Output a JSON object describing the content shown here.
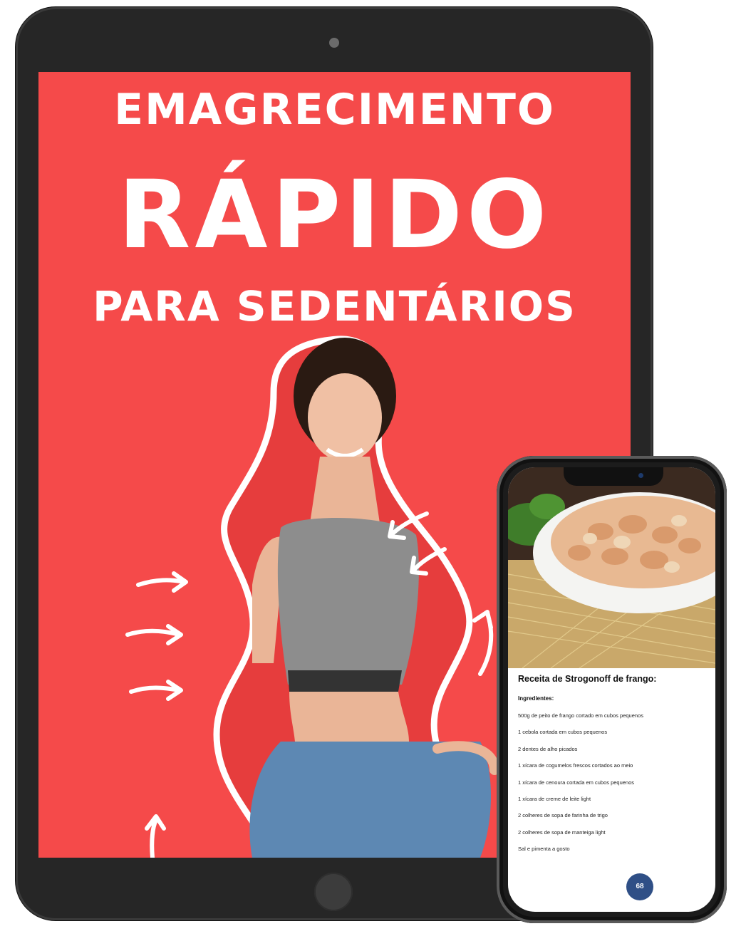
{
  "cover": {
    "title_line1": "EMAGRECIMENTO",
    "title_line2": "RÁPIDO",
    "title_line3": "PARA SEDENTÁRIOS",
    "background_color": "#f54a4a",
    "text_color": "#ffffff"
  },
  "recipe": {
    "title": "Receita de Strogonoff de frango:",
    "ingredients_label": "Ingredientes:",
    "ingredients": [
      "500g de peito de frango cortado em cubos pequenos",
      "1 cebola cortada em cubos pequenos",
      "2 dentes de alho picados",
      "1 xícara de cogumelos frescos cortados ao meio",
      "1 xícara de cenoura cortada em cubos pequenos",
      "1 xícara de creme de leite light",
      "2 colheres de sopa de farinha de trigo",
      "2 colheres de sopa de manteiga light",
      "Sal e pimenta a gosto"
    ],
    "page_number": "68",
    "badge_color": "#2f4f86"
  },
  "icons": [
    "camera-icon",
    "home-button-icon"
  ]
}
